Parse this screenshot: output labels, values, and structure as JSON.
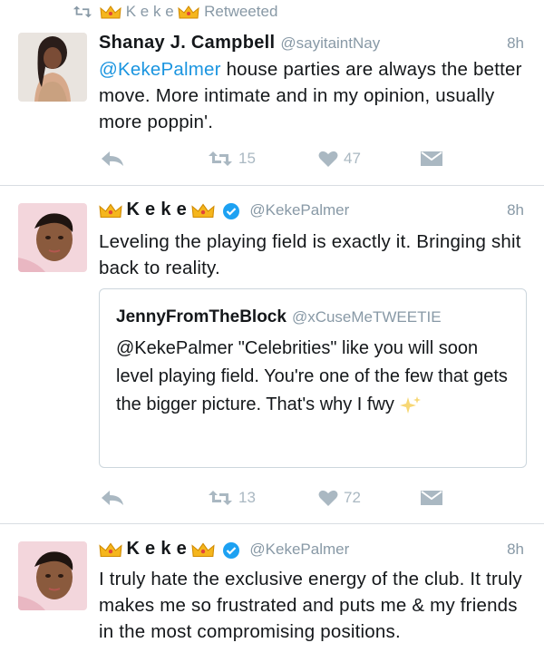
{
  "retweet_context": {
    "name_letters": "K e k e",
    "label": "Retweeted"
  },
  "tweets": [
    {
      "display_name": "Shanay J. Campbell",
      "handle": "@sayitaintNay",
      "time": "8h",
      "mention": "@KekePalmer",
      "text": " house parties are always the better move. More intimate and in my opinion, usually more poppin'.",
      "retweets": "15",
      "likes": "47"
    },
    {
      "display_name": "K e k e",
      "handle": "@KekePalmer",
      "time": "8h",
      "text": "Leveling the playing field is exactly it. Bringing shit back to reality.",
      "quote": {
        "display_name": "JennyFromTheBlock",
        "handle": "@xCuseMeTWEETIE",
        "text": "@KekePalmer \"Celebrities\" like you will soon level playing field. You're one of the few that gets the bigger picture. That's why I fwy"
      },
      "retweets": "13",
      "likes": "72"
    },
    {
      "display_name": "K e k e",
      "handle": "@KekePalmer",
      "time": "8h",
      "text": "I truly hate the exclusive energy of the club. It truly makes me so frustrated and puts me & my friends in the most compromising positions."
    }
  ],
  "colors": {
    "accent": "#1b95e0",
    "muted": "#8899a6",
    "icon": "#aab8c2",
    "verified": "#1da1f2"
  }
}
